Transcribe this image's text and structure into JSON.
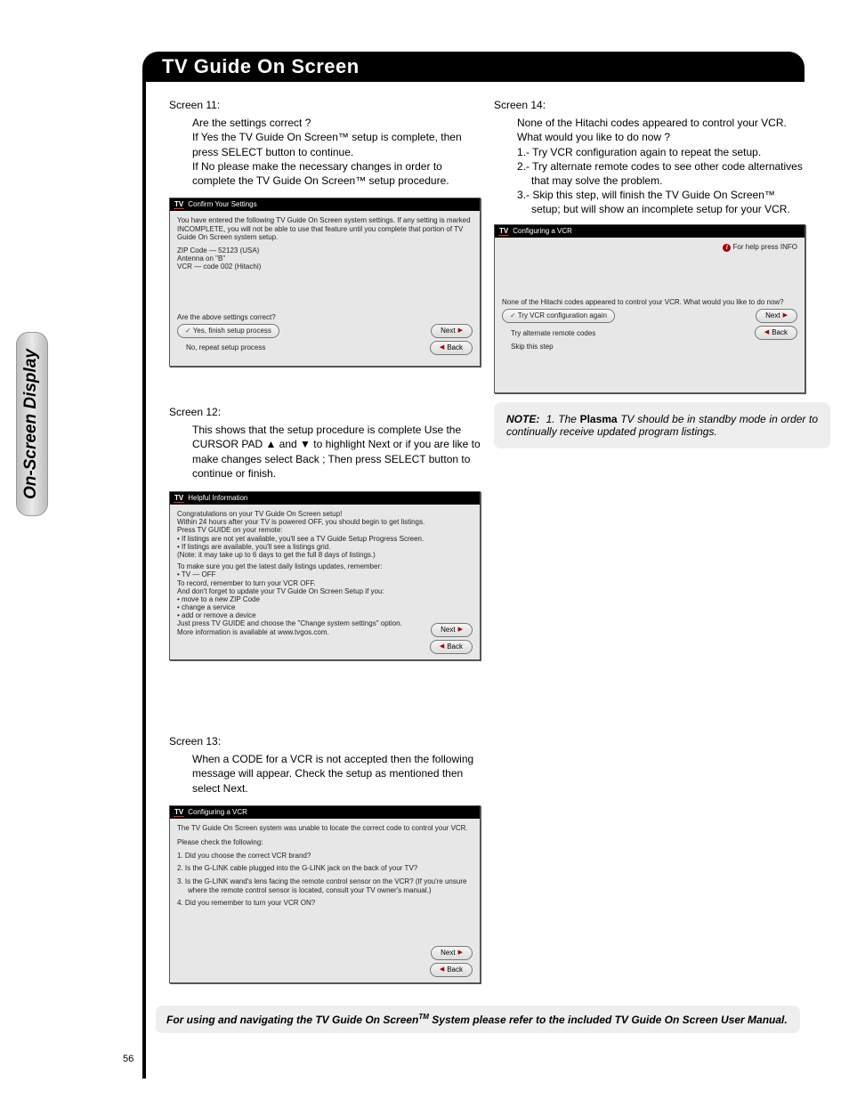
{
  "header": {
    "title": "TV Guide On Screen"
  },
  "sideTab": {
    "label": "On-Screen Display"
  },
  "pageNumber": "56",
  "screen11": {
    "title": "Screen 11:",
    "lines": [
      "Are the settings correct ?",
      "If Yes the TV Guide On Screen™ setup is complete, then press SELECT button to continue.",
      "If No please make the necessary changes in order to complete the TV Guide On Screen™ setup procedure."
    ]
  },
  "screen12": {
    "title": "Screen 12:",
    "lines": [
      "This shows that the setup procedure is complete Use the CURSOR PAD ▲ and ▼ to highlight Next or if you are like to make changes select Back ; Then press SELECT button to continue or finish."
    ]
  },
  "screen13": {
    "title": "Screen 13:",
    "lines": [
      "When a CODE for a VCR is not accepted then the following message will appear. Check the setup as mentioned then select Next."
    ]
  },
  "screen14": {
    "title": "Screen 14:",
    "intro": "None of the Hitachi codes appeared to control your VCR. What would you like to do now ?",
    "items": [
      "1.- Try VCR configuration again to repeat the setup.",
      "2.- Try alternate remote codes to see other code alternatives that may solve the problem.",
      "3.- Skip this step, will finish the TV Guide On Screen™ setup; but will show an incomplete setup for your VCR."
    ]
  },
  "note": {
    "label": "NOTE:",
    "numHead": "1.  The ",
    "strong": "Plasma",
    "rest": " TV should be in standby mode in order to continually receive updated program listings."
  },
  "footer": {
    "pre": "For using and navigating the TV Guide On Screen",
    "post": " System please refer to the included TV Guide On Screen User Manual."
  },
  "ss11": {
    "title": "Confirm Your Settings",
    "msg": "You have entered the following TV Guide On Screen system settings. If any setting is marked INCOMPLETE, you will not be able to use that feature until you complete that portion of TV Guide On Screen system setup.",
    "l1": "ZIP Code — 52123 (USA)",
    "l2": "Antenna on \"B\"",
    "l3": "VCR — code 002 (Hitachi)",
    "q": "Are the above settings correct?",
    "optYes": "Yes, finish setup process",
    "optNo": "No, repeat setup process",
    "next": "Next",
    "back": "Back"
  },
  "ss12": {
    "title": "Helpful Information",
    "p1": "Congratulations on your TV Guide On Screen setup!",
    "p2": "Within 24 hours after your TV is powered OFF, you should begin to get listings.",
    "p3": "Press TV GUIDE on your remote:",
    "p3a": "• If listings are not yet available, you'll see a TV Guide Setup Progress Screen.",
    "p3b": "• If listings are available, you'll see a listings grid.",
    "p3c": "(Note: it may take up to 6 days to get the full 8 days of listings.)",
    "p4": "To make sure you get the latest daily listings updates, remember:",
    "p4a": "• TV — OFF",
    "p5": "To record, remember to turn your VCR OFF.",
    "p6": "And don't forget to update your TV Guide On Screen Setup if you:",
    "p6a": "• move to a new ZIP Code",
    "p6b": "• change a service",
    "p6c": "• add or remove a device",
    "p7": "Just press TV GUIDE and choose the \"Change system settings\" option.",
    "p8": "More information is available at www.tvgos.com.",
    "next": "Next",
    "back": "Back"
  },
  "ss13": {
    "title": "Configuring a VCR",
    "msg": "The TV Guide On Screen system was unable to locate the correct code to control your VCR.",
    "chk": "Please check the following:",
    "q1": "1.  Did you choose the correct VCR brand?",
    "q2": "2.  Is the G-LINK cable plugged into the G-LINK jack on the back of your TV?",
    "q3": "3.  Is the G-LINK wand's lens facing the remote control sensor on the VCR? (If you're unsure where the remote control sensor is located, consult your TV owner's manual.)",
    "q4": "4.  Did you remember to turn your VCR ON?",
    "next": "Next",
    "back": "Back"
  },
  "ss14": {
    "title": "Configuring a VCR",
    "help": "For help press INFO",
    "q": "None of the Hitachi codes appeared to control your VCR.  What would you like to do now?",
    "opt1": "Try VCR configuration again",
    "opt2": "Try alternate remote codes",
    "opt3": "Skip this step",
    "next": "Next",
    "back": "Back"
  }
}
